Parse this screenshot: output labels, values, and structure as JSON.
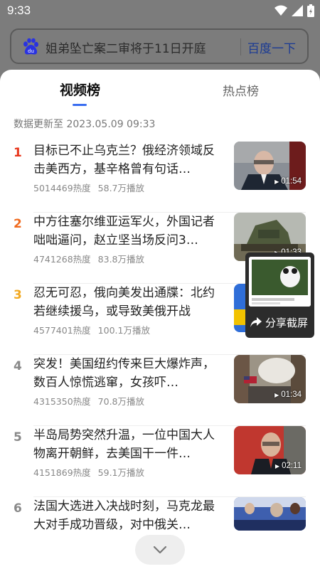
{
  "status_bar": {
    "time": "9:33"
  },
  "search": {
    "query": "姐弟坠亡案二审将于11日开庭",
    "button": "百度一下"
  },
  "tabs": [
    {
      "label": "视频榜",
      "active": true
    },
    {
      "label": "热点榜",
      "active": false
    }
  ],
  "update_time": "数据更新至 2023.05.09 09:33",
  "items": [
    {
      "rank": "1",
      "rank_color": "#e8361c",
      "title": "目标已不止乌克兰？俄经济领域反击美西方，基辛格曾有句话…",
      "heat": "5014469热度",
      "plays": "58.7万播放",
      "duration": "01:54"
    },
    {
      "rank": "2",
      "rank_color": "#f06a1e",
      "title": "中方往塞尔维亚运军火，外国记者咄咄逼问，赵立坚当场反问3…",
      "heat": "4741268热度",
      "plays": "83.8万播放",
      "duration": "01:33"
    },
    {
      "rank": "3",
      "rank_color": "#f2a81f",
      "title": "忍无可忍，俄向美发出通牒：北约若继续援乌，或导致美俄开战",
      "heat": "4577401热度",
      "plays": "100.1万播放",
      "duration": ""
    },
    {
      "rank": "4",
      "rank_color": "#888888",
      "title": "突发！美国纽约传来巨大爆炸声，数百人惊慌逃窜，女孩吓…",
      "heat": "4315350热度",
      "plays": "70.8万播放",
      "duration": "01:34"
    },
    {
      "rank": "5",
      "rank_color": "#888888",
      "title": "半岛局势突然升温，一位中国大人物离开朝鲜，去美国干一件…",
      "heat": "4151869热度",
      "plays": "59.1万播放",
      "duration": "02:11"
    },
    {
      "rank": "6",
      "rank_color": "#888888",
      "title": "法国大选进入决战时刻，马克龙最大对手成功晋级，对中俄关…",
      "heat": "",
      "plays": "",
      "duration": ""
    }
  ],
  "share_popup": {
    "label": "分享截屏"
  },
  "colors": {
    "accent": "#3a6df0",
    "brand_blue": "#2932e1"
  },
  "icons": [
    "wifi-icon",
    "signal-icon",
    "battery-icon",
    "baidu-paw-icon",
    "share-arrow-icon",
    "chevron-down-icon",
    "play-icon"
  ]
}
